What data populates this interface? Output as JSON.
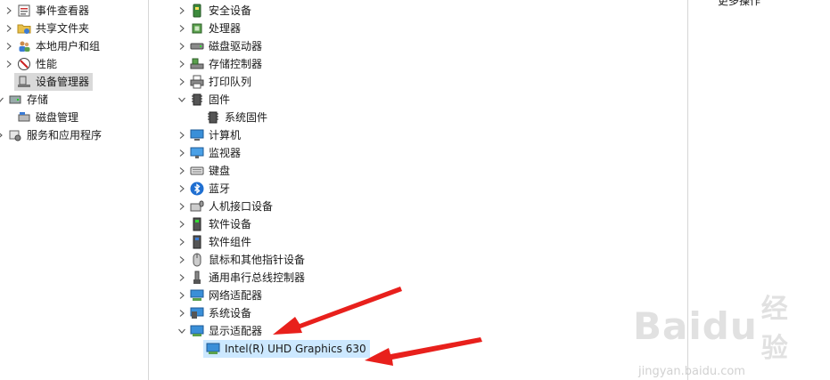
{
  "left_tree": [
    {
      "label": "事件查看器",
      "icon": "event-viewer-icon",
      "chevron": "right"
    },
    {
      "label": "共享文件夹",
      "icon": "shared-folder-icon",
      "chevron": "right"
    },
    {
      "label": "本地用户和组",
      "icon": "users-group-icon",
      "chevron": "right"
    },
    {
      "label": "性能",
      "icon": "performance-icon",
      "chevron": "right"
    },
    {
      "label": "设备管理器",
      "icon": "device-manager-icon",
      "chevron": "none",
      "selected": true
    },
    {
      "label": "存储",
      "icon": "storage-icon",
      "chevron": "down"
    },
    {
      "label": "磁盘管理",
      "icon": "disk-management-icon",
      "chevron": "none"
    },
    {
      "label": "服务和应用程序",
      "icon": "services-icon",
      "chevron": "right"
    }
  ],
  "device_tree": [
    {
      "label": "安全设备",
      "icon": "security-device-icon",
      "chevron": "right"
    },
    {
      "label": "处理器",
      "icon": "processor-icon",
      "chevron": "right"
    },
    {
      "label": "磁盘驱动器",
      "icon": "disk-drive-icon",
      "chevron": "right"
    },
    {
      "label": "存储控制器",
      "icon": "storage-controller-icon",
      "chevron": "right"
    },
    {
      "label": "打印队列",
      "icon": "printer-icon",
      "chevron": "right"
    },
    {
      "label": "固件",
      "icon": "firmware-icon",
      "chevron": "down"
    },
    {
      "label": "系统固件",
      "icon": "firmware-icon",
      "chevron": "none",
      "child": true
    },
    {
      "label": "计算机",
      "icon": "computer-icon",
      "chevron": "right"
    },
    {
      "label": "监视器",
      "icon": "monitor-icon",
      "chevron": "right"
    },
    {
      "label": "键盘",
      "icon": "keyboard-icon",
      "chevron": "right"
    },
    {
      "label": "蓝牙",
      "icon": "bluetooth-icon",
      "chevron": "right"
    },
    {
      "label": "人机接口设备",
      "icon": "hid-icon",
      "chevron": "right"
    },
    {
      "label": "软件设备",
      "icon": "software-device-icon",
      "chevron": "right"
    },
    {
      "label": "软件组件",
      "icon": "software-component-icon",
      "chevron": "right"
    },
    {
      "label": "鼠标和其他指针设备",
      "icon": "mouse-icon",
      "chevron": "right"
    },
    {
      "label": "通用串行总线控制器",
      "icon": "usb-icon",
      "chevron": "right"
    },
    {
      "label": "网络适配器",
      "icon": "network-adapter-icon",
      "chevron": "right"
    },
    {
      "label": "系统设备",
      "icon": "system-device-icon",
      "chevron": "right"
    },
    {
      "label": "显示适配器",
      "icon": "display-adapter-icon",
      "chevron": "down"
    },
    {
      "label": "Intel(R) UHD Graphics 630",
      "icon": "display-adapter-icon",
      "chevron": "none",
      "child": true,
      "selected": true
    }
  ],
  "actions": {
    "more_actions": "更多操作"
  },
  "watermark": {
    "brand": "Baidu",
    "brand_cn": "经验",
    "url": "jingyan.baidu.com"
  },
  "colors": {
    "selection_gray": "#d9d9d9",
    "selection_blue": "#cce8ff",
    "annotation_red": "#e8201c"
  }
}
